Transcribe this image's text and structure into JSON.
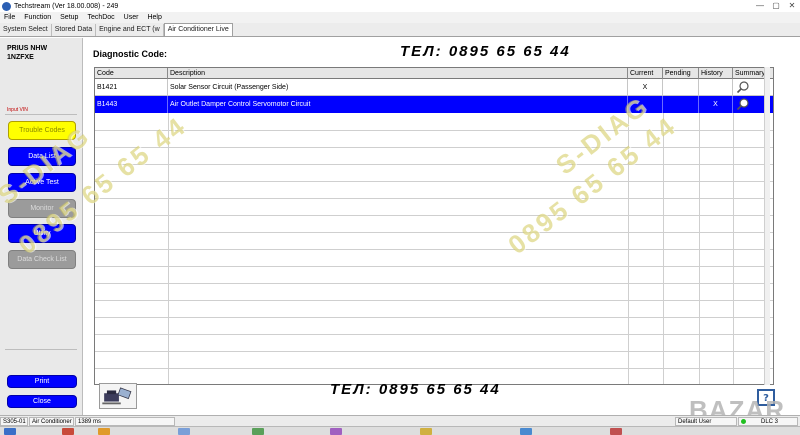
{
  "window": {
    "title": "Techstream (Ver 18.00.008) - 249",
    "controls": [
      "—",
      "▢",
      "✕"
    ]
  },
  "menu": {
    "items": [
      "File",
      "Function",
      "Setup",
      "TechDoc",
      "User",
      "Help"
    ]
  },
  "tabs": [
    {
      "label": "System Select"
    },
    {
      "label": "Stored Data"
    },
    {
      "label": "Engine and ECT (w"
    },
    {
      "label": "Air Conditioner Live"
    }
  ],
  "sidebar": {
    "vehicle_line1": "PRIUS NHW",
    "vehicle_line2": "1NZFXE",
    "input_vin": "Input VIN",
    "buttons": [
      {
        "label": "Trouble Codes",
        "state": "active"
      },
      {
        "label": "Data List",
        "state": "enabled"
      },
      {
        "label": "Active Test",
        "state": "enabled"
      },
      {
        "label": "Monitor",
        "state": "disabled"
      },
      {
        "label": "Utility",
        "state": "enabled"
      },
      {
        "label": "Data Check List",
        "state": "disabled"
      }
    ],
    "print_label": "Print",
    "close_label": "Close"
  },
  "main": {
    "title": "Diagnostic Code:",
    "phone_top": "ТЕЛ:  0895  65  65  44",
    "phone_bottom": "ТЕЛ:  0895  65  65  44",
    "columns": [
      "Code",
      "Description",
      "Current",
      "Pending",
      "History",
      "Summary"
    ],
    "rows": [
      {
        "code": "B1421",
        "description": "Solar Sensor Circuit (Passenger Side)",
        "current": "X",
        "pending": "",
        "history": "",
        "selected": false
      },
      {
        "code": "B1443",
        "description": "Air Outlet Damper Control Servomotor Circuit",
        "current": "",
        "pending": "",
        "history": "X",
        "selected": true
      }
    ]
  },
  "watermarks": {
    "left_brand": "S-DIAG",
    "left_number": "0895  65  65  44",
    "right_brand": "S-DIAG",
    "right_number": "0895  65  65  44",
    "bazar": "BAZAR"
  },
  "status": {
    "code": "S305-01",
    "system": "Air Conditioner",
    "time": "1389 ms",
    "user": "Default User",
    "dlc": "DLC 3"
  },
  "colors": {
    "accent_blue": "#0000ff",
    "active_yellow": "#ffff00",
    "disabled_gray": "#9b9b9b",
    "watermark": "#d2c85a"
  }
}
